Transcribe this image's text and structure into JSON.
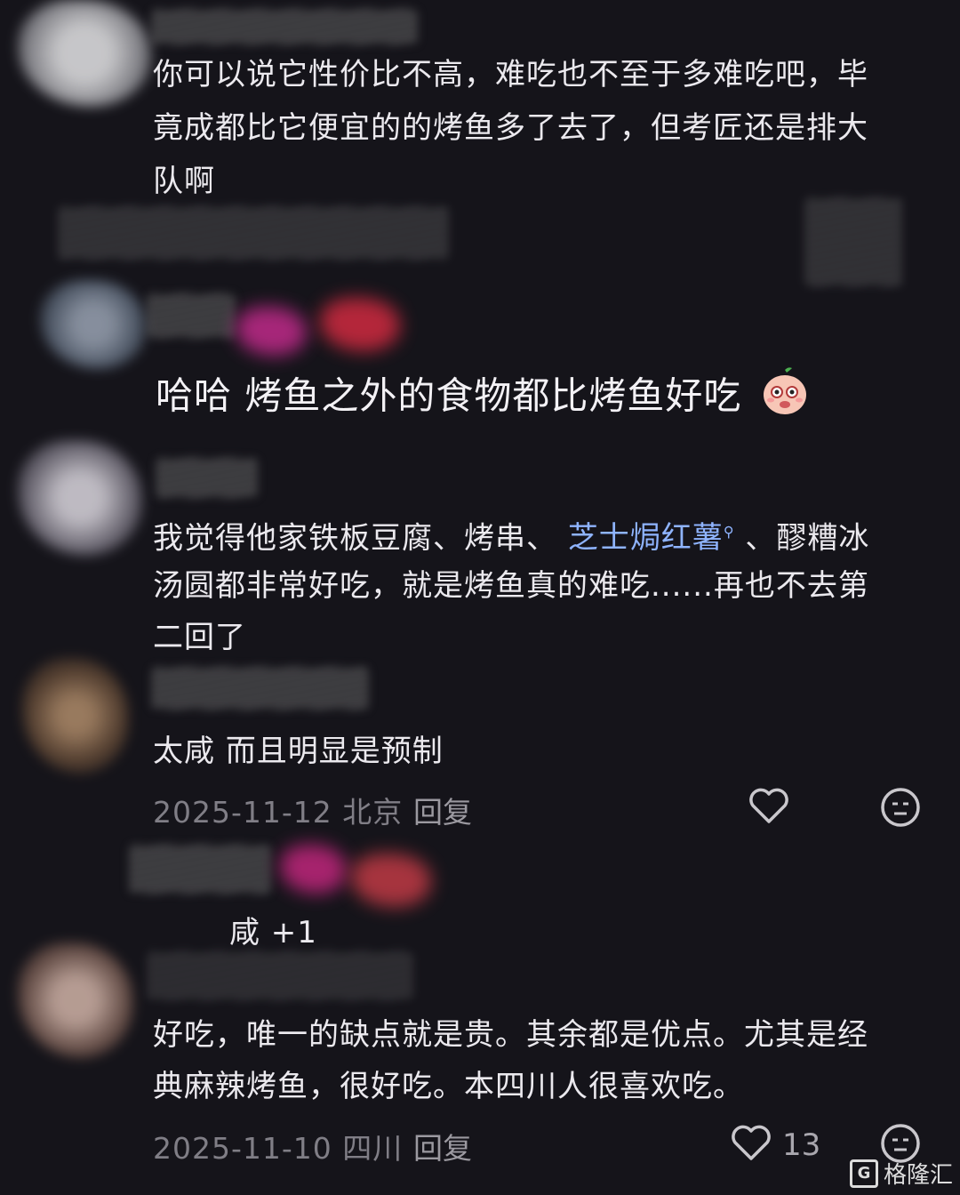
{
  "comments": [
    {
      "lines": [
        "你可以说它性价比不高，难吃也不至于多难吃吧，毕",
        "竟成都比它便宜的的烤鱼多了去了，但考匠还是排大",
        "队啊"
      ]
    },
    {
      "text": "哈哈 烤鱼之外的食物都比烤鱼好吃",
      "emoji_icon": "peach-face-emoji-icon"
    },
    {
      "line1_before": "我觉得他家铁板豆腐、烤串、",
      "line1_link": "芝士焗红薯",
      "line1_after": "、醪糟冰",
      "lines": [
        "汤圆都非常好吃，就是烤鱼真的难吃......再也不去第",
        "二回了"
      ]
    },
    {
      "text": "太咸 而且明显是预制",
      "date_location": "2025-11-12 北京",
      "reply_label": "回复"
    },
    {
      "text": "咸 +1"
    },
    {
      "lines": [
        "好吃，唯一的缺点就是贵。其余都是优点。尤其是经",
        "典麻辣烤鱼，很好吃。本四川人很喜欢吃。"
      ],
      "date_location": "2025-11-10 四川",
      "reply_label": "回复",
      "like_count": "13"
    }
  ],
  "watermark": {
    "logo_letter": "G",
    "text": "格隆汇"
  },
  "colors": {
    "background": "#15141a",
    "link": "#8fb4ff",
    "meta": "#807e86"
  }
}
